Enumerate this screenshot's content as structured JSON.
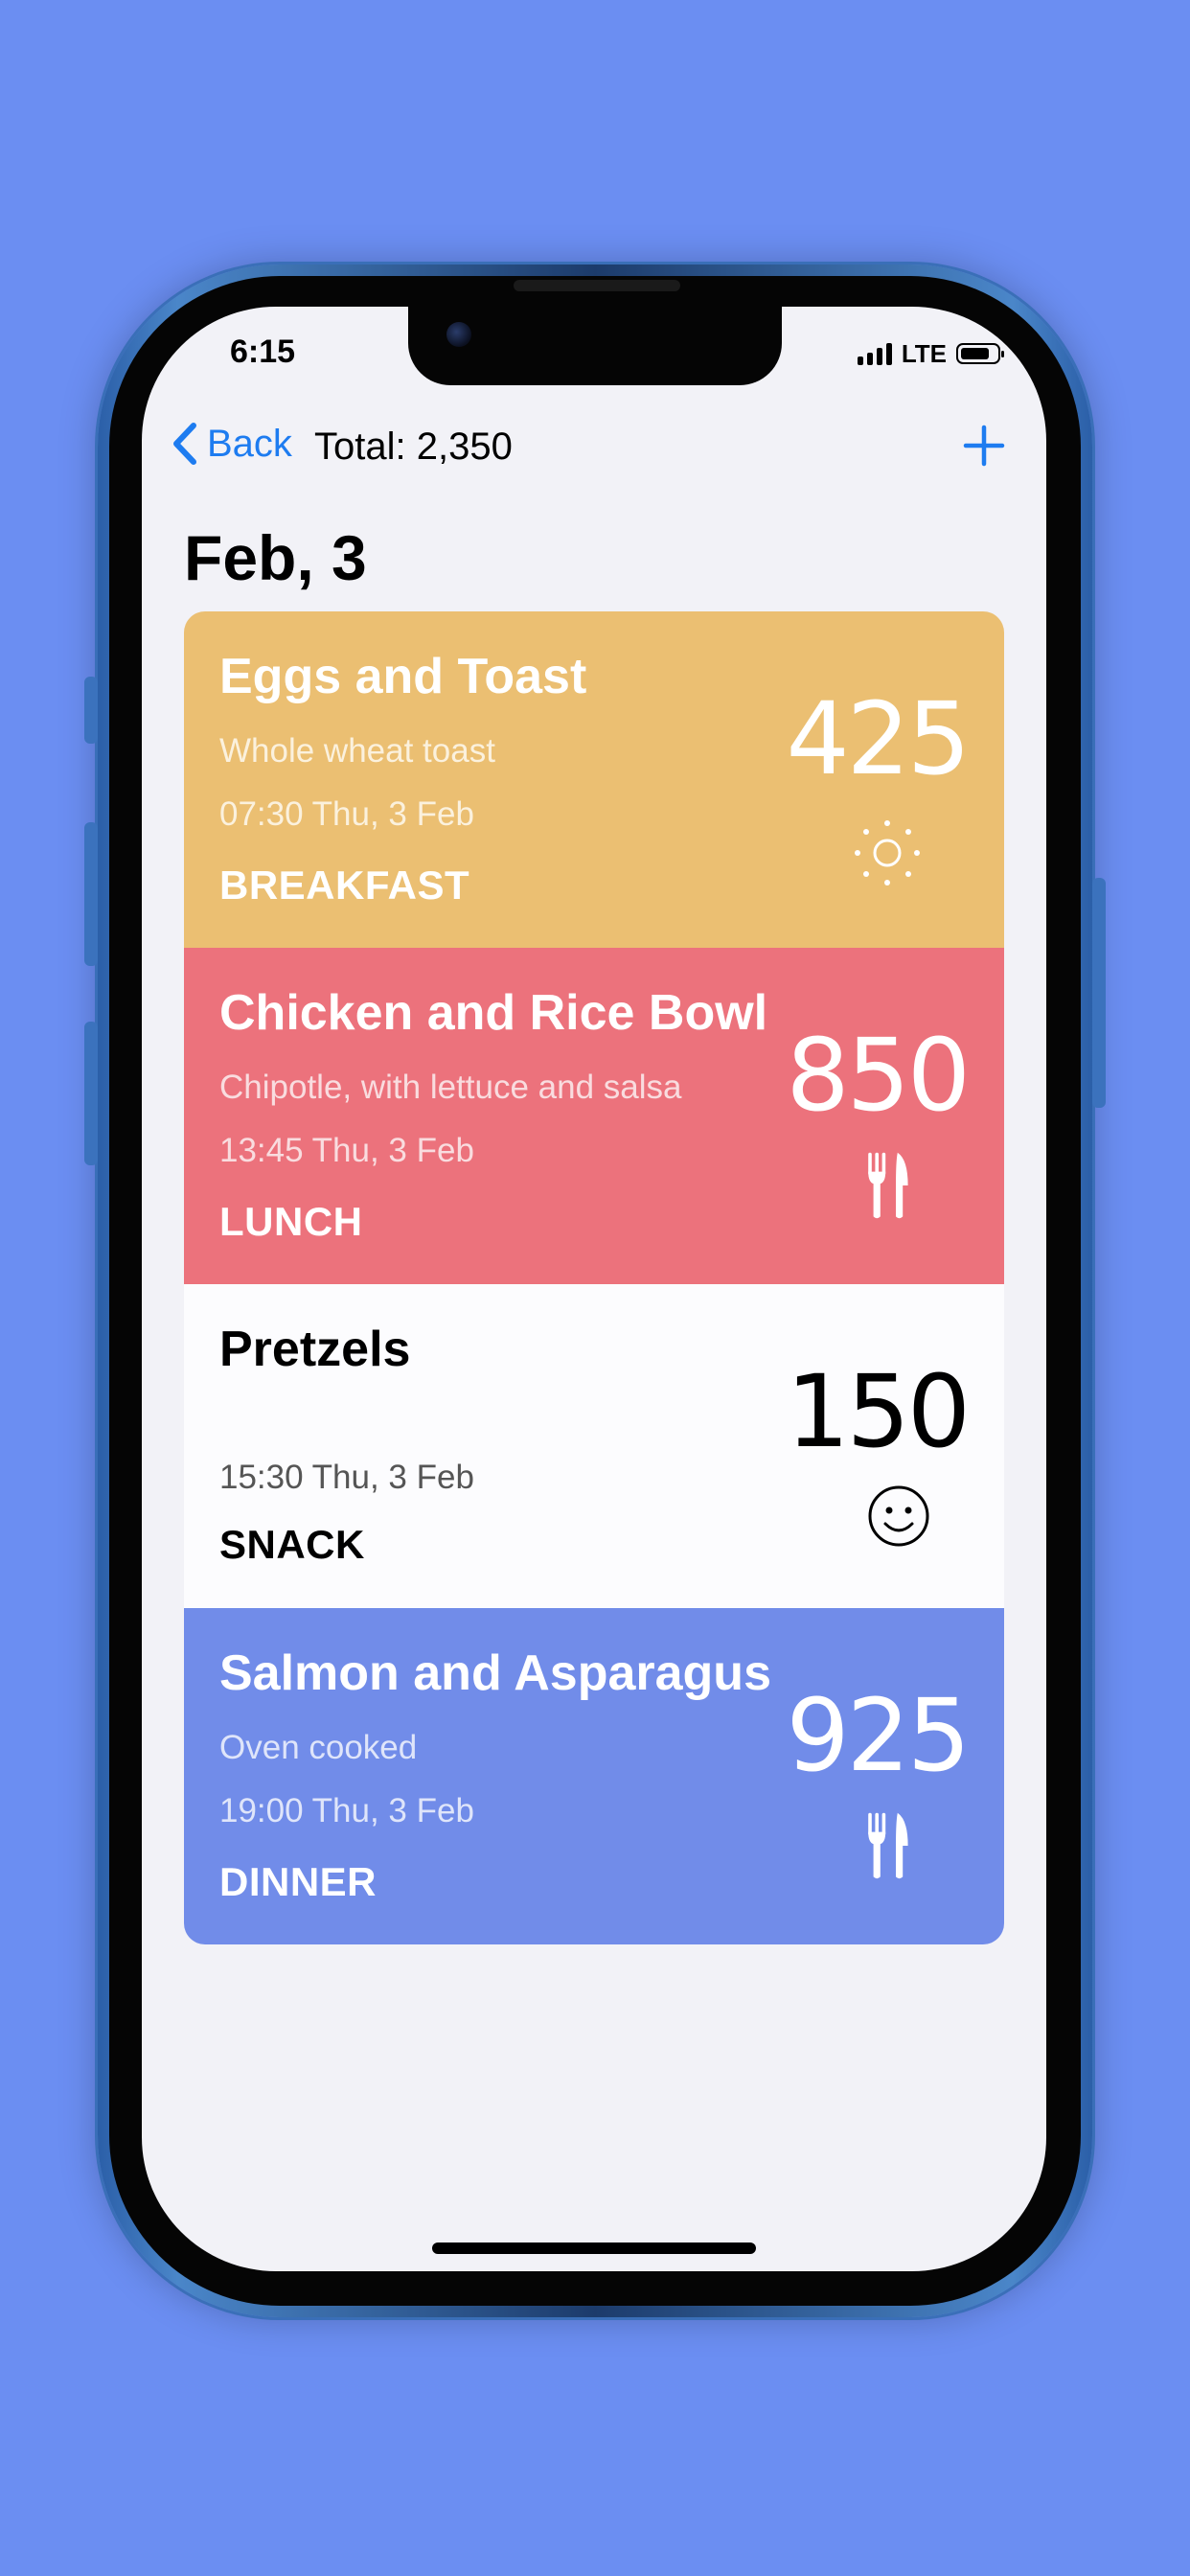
{
  "status_bar": {
    "time": "6:15",
    "network": "LTE"
  },
  "nav": {
    "back_label": "Back",
    "total_label": "Total: 2,350",
    "add_icon": "plus-icon"
  },
  "page_title": "Feb, 3",
  "meals": [
    {
      "name": "Eggs and Toast",
      "description": "Whole wheat toast",
      "time": "07:30 Thu, 3 Feb",
      "type": "BREAKFAST",
      "calories": "425",
      "icon": "sun-icon",
      "background": "#ebbf72",
      "text_color": "#ffffff",
      "sub_text_color": "#fbf1dd"
    },
    {
      "name": "Chicken and Rice Bowl",
      "description": "Chipotle, with lettuce and salsa",
      "time": "13:45 Thu, 3 Feb",
      "type": "LUNCH",
      "calories": "850",
      "icon": "fork-knife-icon",
      "background": "#ec727c",
      "text_color": "#ffffff",
      "sub_text_color": "#f9dcdf"
    },
    {
      "name": "Pretzels",
      "description": "",
      "time": "15:30 Thu, 3 Feb",
      "type": "SNACK",
      "calories": "150",
      "icon": "smiley-icon",
      "background": "#fcfcfe",
      "text_color": "#000000",
      "sub_text_color": "#555555"
    },
    {
      "name": "Salmon and Asparagus",
      "description": "Oven cooked",
      "time": "19:00 Thu, 3 Feb",
      "type": "DINNER",
      "calories": "925",
      "icon": "fork-knife-icon",
      "background": "#718ce9",
      "text_color": "#ffffff",
      "sub_text_color": "#dfe5fa"
    }
  ],
  "colors": {
    "background": "#6b8ef2",
    "accent": "#1e7cf0",
    "screen": "#f2f2f7"
  }
}
